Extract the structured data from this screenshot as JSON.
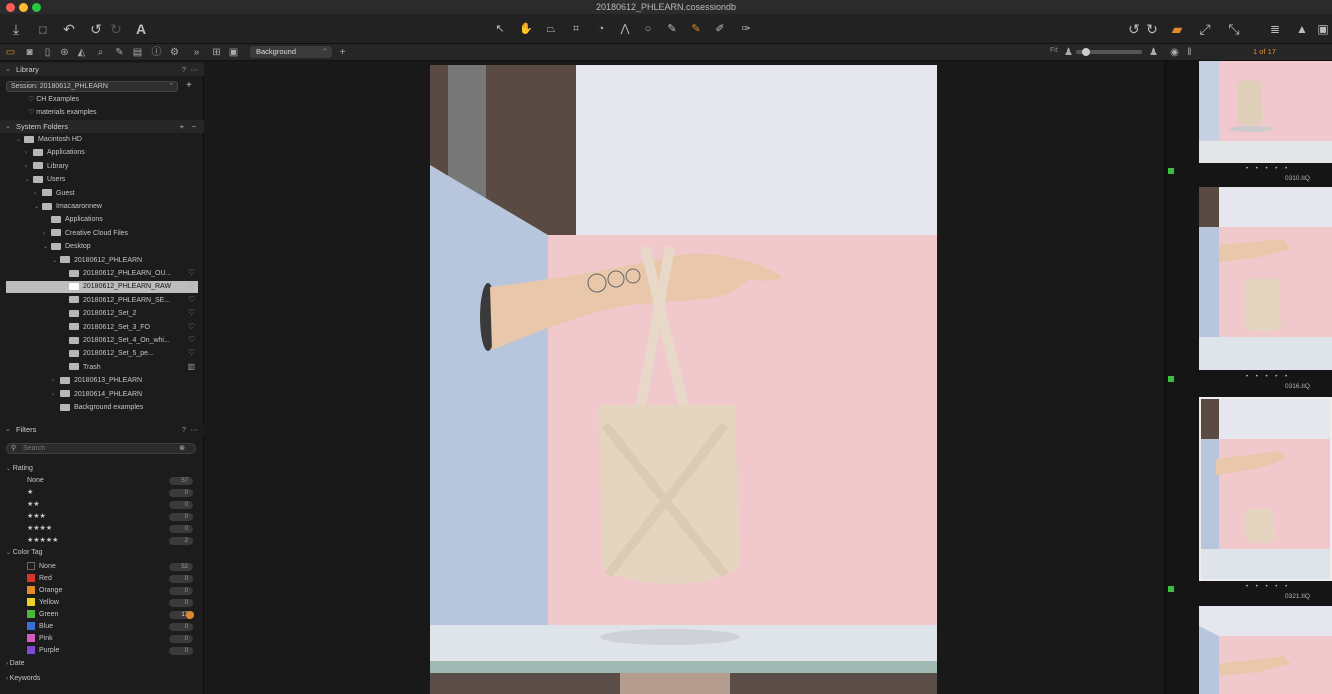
{
  "window": {
    "title": "20180612_PHLEARN.cosessiondb",
    "traffic_lights": {
      "close": "#ff5f57",
      "minimize": "#febc2e",
      "zoom": "#28c840"
    }
  },
  "toolbar": {
    "left_icons": [
      "import-icon",
      "camera-icon",
      "undo-history-icon",
      "undo-icon",
      "redo-icon",
      "text-icon"
    ],
    "center_icons": [
      "select-icon",
      "pan-icon",
      "keystone-icon",
      "crop-icon",
      "rotate-icon",
      "straighten-icon",
      "circle-icon",
      "brush-icon",
      "color-picker-icon",
      "eraser-icon",
      "gradient-icon"
    ],
    "right_icons": [
      "rotate-left-icon",
      "rotate-right-icon",
      "stack-icon",
      "expand-icon",
      "compare-icon",
      "grid-icon",
      "warning-icon",
      "layout-icon"
    ],
    "accent": "#e08a2e"
  },
  "subbar": {
    "preset_label": "Background",
    "fit_label": "Fit",
    "counter": "1 of 17"
  },
  "library": {
    "header": "Library",
    "help": "?",
    "session": "Session: 20180612_PHLEARN",
    "albums": [
      "CH Examples",
      "materials examples"
    ],
    "system_folders_header": "System Folders",
    "tree": [
      {
        "label": "Macintosh HD",
        "depth": 0
      },
      {
        "label": "Applications",
        "depth": 1
      },
      {
        "label": "Library",
        "depth": 1
      },
      {
        "label": "Users",
        "depth": 1
      },
      {
        "label": "Guest",
        "depth": 2
      },
      {
        "label": "Imacaaronnew",
        "depth": 2
      },
      {
        "label": "Applications",
        "depth": 3
      },
      {
        "label": "Creative Cloud Files",
        "depth": 3
      },
      {
        "label": "Desktop",
        "depth": 3
      },
      {
        "label": "20180612_PHLEARN",
        "depth": 4
      },
      {
        "label": "20180612_PHLEARN_OU...",
        "depth": 5
      },
      {
        "label": "20180612_PHLEARN_RAW",
        "depth": 5
      },
      {
        "label": "20180612_PHLEARN_SE...",
        "depth": 5
      },
      {
        "label": "20180612_Set_2",
        "depth": 5
      },
      {
        "label": "20180612_Set_3_FO",
        "depth": 5
      },
      {
        "label": "20180612_Set_4_On_whi...",
        "depth": 5
      },
      {
        "label": "20180612_Set_5_pe...",
        "depth": 5
      },
      {
        "label": "Trash",
        "depth": 5
      },
      {
        "label": "20180613_PHLEARN",
        "depth": 4
      },
      {
        "label": "20180614_PHLEARN",
        "depth": 4
      },
      {
        "label": "Background examples",
        "depth": 4
      }
    ]
  },
  "filters": {
    "header": "Filters",
    "help": "?",
    "search_placeholder": "Search",
    "rating_header": "Rating",
    "ratings": [
      {
        "label": "None",
        "count": "57"
      },
      {
        "label": "★",
        "count": "0"
      },
      {
        "label": "★★",
        "count": "0"
      },
      {
        "label": "★★★",
        "count": "0"
      },
      {
        "label": "★★★★",
        "count": "0"
      },
      {
        "label": "★★★★★",
        "count": "2"
      }
    ],
    "color_tag_header": "Color Tag",
    "colors": [
      {
        "label": "None",
        "count": "52",
        "color": "#1c1c1c"
      },
      {
        "label": "Red",
        "count": "0",
        "color": "#d9342b"
      },
      {
        "label": "Orange",
        "count": "0",
        "color": "#e58b2a"
      },
      {
        "label": "Yellow",
        "count": "0",
        "color": "#e8d12b"
      },
      {
        "label": "Green",
        "count": "17",
        "color": "#4db53c"
      },
      {
        "label": "Blue",
        "count": "0",
        "color": "#3a6fd8"
      },
      {
        "label": "Pink",
        "count": "0",
        "color": "#d65bc1"
      },
      {
        "label": "Purple",
        "count": "0",
        "color": "#7d4bd1"
      }
    ],
    "date_header": "Date",
    "keywords_header": "Keywords"
  },
  "thumbnails": [
    {
      "filename": "0310.IIQ",
      "stars": "• • • • •"
    },
    {
      "filename": "0316.IIQ",
      "stars": "• • • • •"
    },
    {
      "filename": "0321.IIQ",
      "stars": "• • • • •"
    }
  ]
}
